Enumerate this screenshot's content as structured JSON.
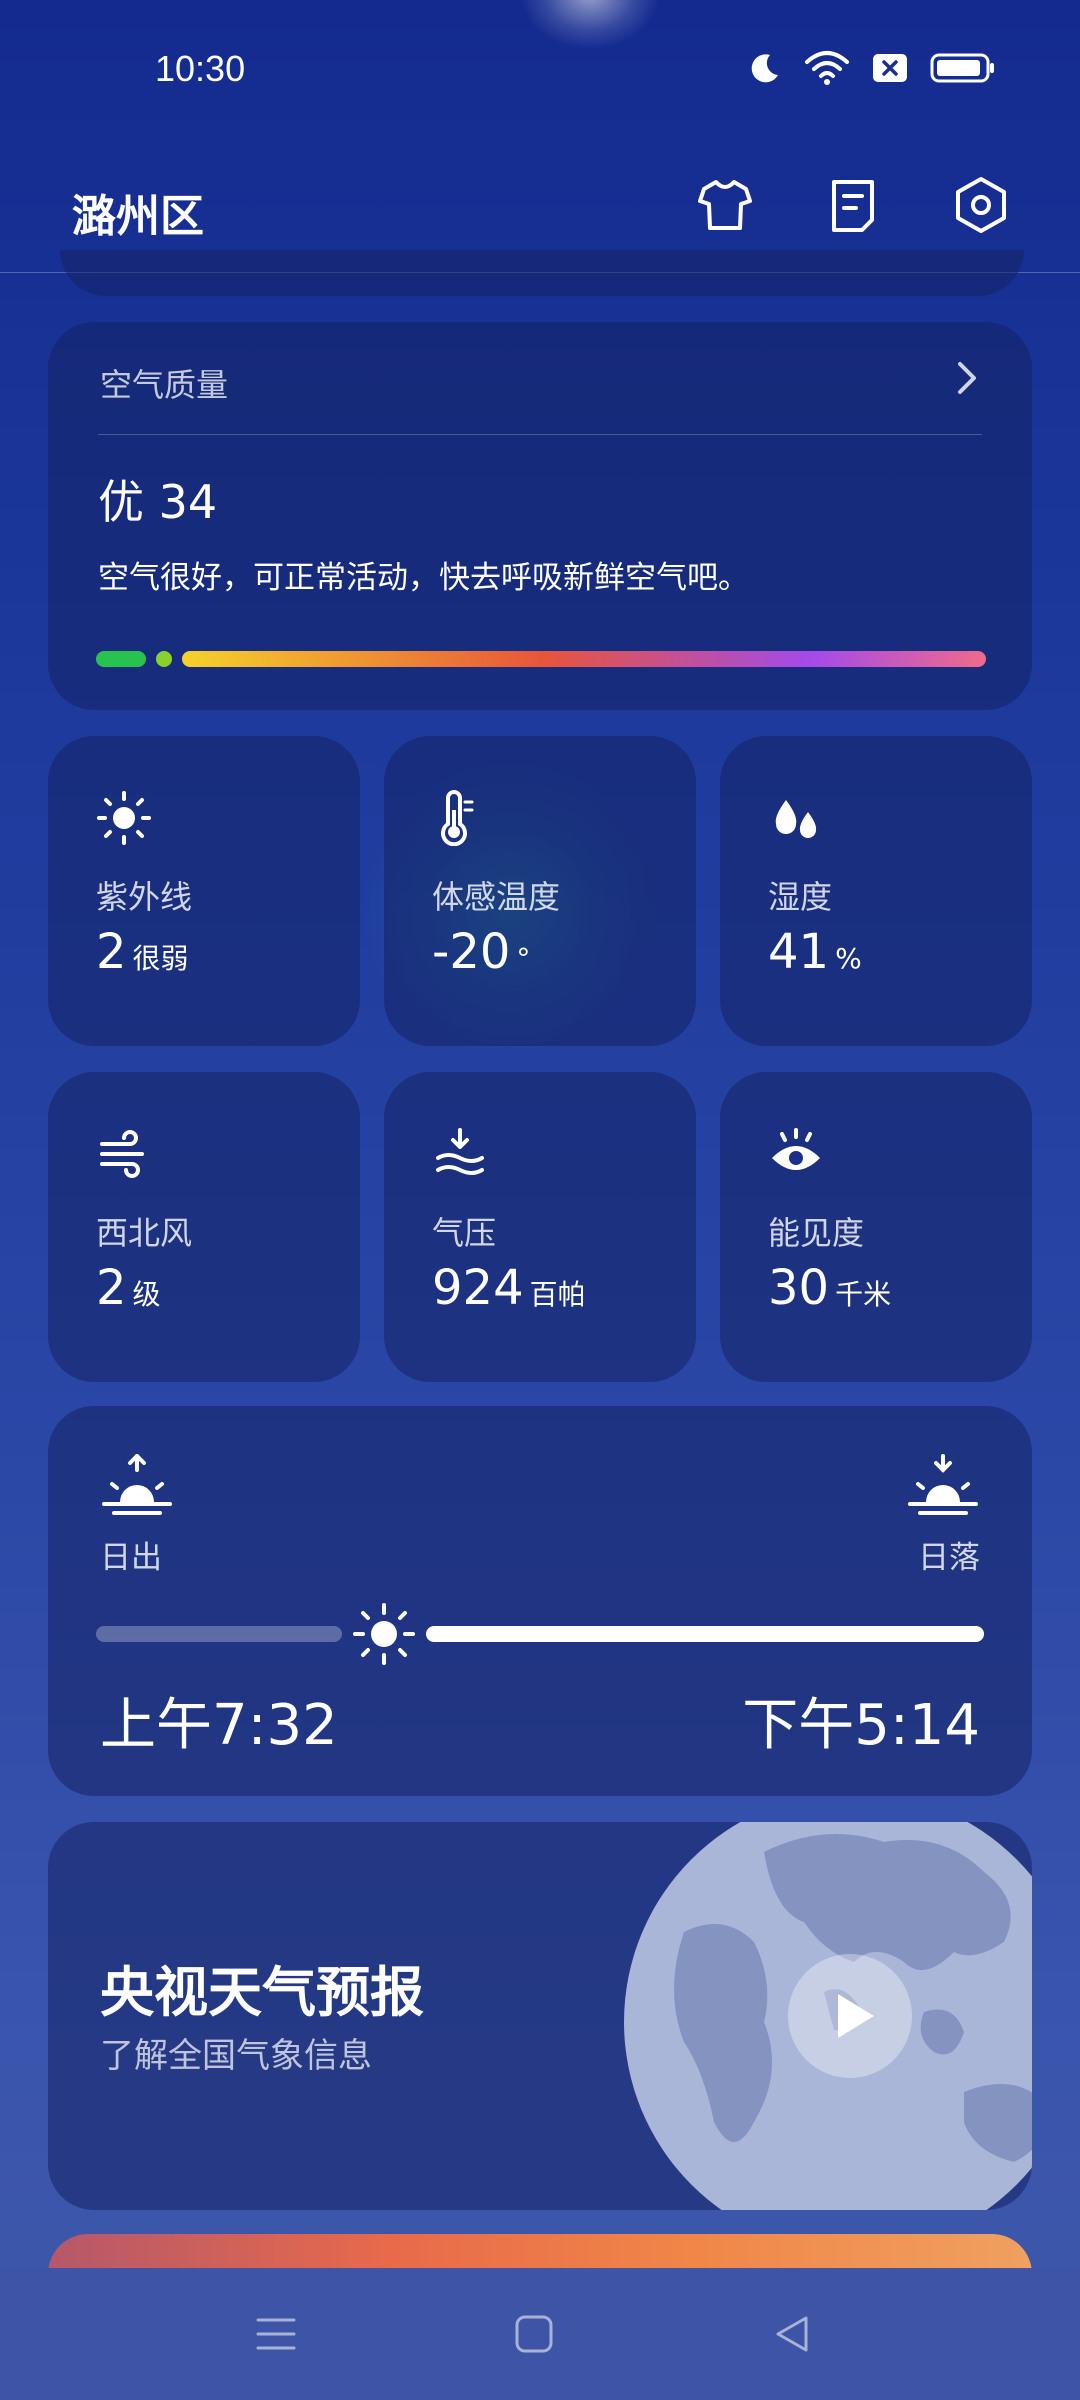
{
  "status_bar": {
    "time": "10:30",
    "icons": [
      "moon-icon",
      "wifi-icon",
      "sim-off-icon",
      "battery-icon"
    ]
  },
  "header": {
    "city": "潞州区",
    "icons": [
      "shirt-icon",
      "document-icon",
      "settings-icon"
    ]
  },
  "air_quality": {
    "title": "空气质量",
    "value": "优 34",
    "description": "空气很好，可正常活动，快去呼吸新鲜空气吧。",
    "colors": {
      "good": "#27c34e",
      "bar_start": "#f5d22a",
      "bar_mid": "#e8553a",
      "bar_purple": "#a34bea",
      "bar_end": "#f06a8a"
    }
  },
  "tiles": [
    {
      "icon": "sun-icon",
      "label": "紫外线",
      "value": "2",
      "unit": "很弱"
    },
    {
      "icon": "thermometer-icon",
      "label": "体感温度",
      "value": "-20",
      "unit": "°"
    },
    {
      "icon": "droplets-icon",
      "label": "湿度",
      "value": "41",
      "unit": "%"
    },
    {
      "icon": "wind-icon",
      "label": "西北风",
      "value": "2",
      "unit": "级"
    },
    {
      "icon": "pressure-icon",
      "label": "气压",
      "value": "924",
      "unit": "百帕"
    },
    {
      "icon": "eye-icon",
      "label": "能见度",
      "value": "30",
      "unit": "千米"
    }
  ],
  "sun": {
    "sunrise_label": "日出",
    "sunset_label": "日落",
    "sunrise_time": "上午7:32",
    "sunset_time": "下午5:14",
    "progress": 0.3
  },
  "cctv": {
    "title": "央视天气预报",
    "subtitle": "了解全国气象信息"
  },
  "nav": [
    "menu-icon",
    "home-icon",
    "back-icon"
  ]
}
